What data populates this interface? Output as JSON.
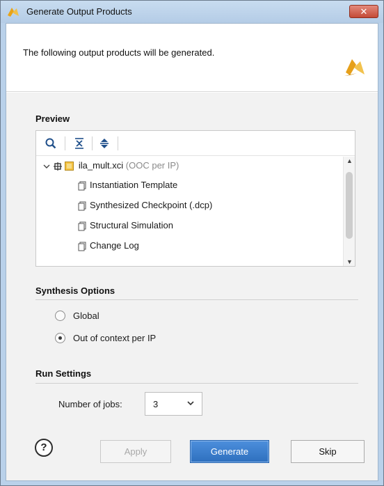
{
  "window": {
    "title": "Generate Output Products",
    "close_label": "✕"
  },
  "header": {
    "message": "The following output products will be generated."
  },
  "preview": {
    "title": "Preview",
    "toolbar_icons": [
      "search-icon",
      "collapse-all-icon",
      "expand-all-icon"
    ],
    "tree": {
      "root": {
        "name": "ila_mult.xci",
        "note": "(OOC per IP)"
      },
      "children": [
        "Instantiation Template",
        "Synthesized Checkpoint (.dcp)",
        "Structural Simulation",
        "Change Log"
      ]
    }
  },
  "synthesis": {
    "title": "Synthesis Options",
    "options": [
      {
        "label": "Global",
        "checked": false
      },
      {
        "label": "Out of context per IP",
        "checked": true
      }
    ]
  },
  "run_settings": {
    "title": "Run Settings",
    "jobs_label": "Number of jobs:",
    "jobs_value": "3"
  },
  "buttons": {
    "help": "?",
    "apply": "Apply",
    "generate": "Generate",
    "skip": "Skip"
  },
  "colors": {
    "accent": "#2e6fbe",
    "logo": "#e3a21a"
  }
}
